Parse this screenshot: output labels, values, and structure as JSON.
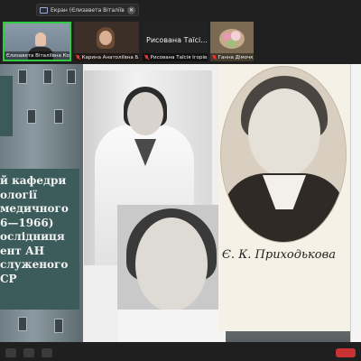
{
  "share_bar": {
    "text": "Екран (Єлизавета Віталіївна Ко",
    "icon": "screen-share-icon"
  },
  "participants": [
    {
      "name": "Єлизавета Віталіївна Кост",
      "muted": false,
      "active": true
    },
    {
      "name": "Карина Анатоліївна Б...",
      "muted": true
    },
    {
      "name": "Рисована Таїсія Ігорів...",
      "muted": true,
      "tile_title": "Рисована Таїсі..."
    },
    {
      "name": "Ганна Дімочка",
      "muted": true
    }
  ],
  "slide": {
    "info_lines": [
      "й кафедри",
      "ології",
      "медичного",
      "6—1966)",
      "ослідниця",
      "",
      "ент    АН",
      "",
      "служеного",
      "СР"
    ],
    "caption": "Є. К. Приходькова"
  },
  "colors": {
    "active_speaker": "#2ecc40",
    "info_box": "#3c5b5b",
    "muted": "#ee3333"
  }
}
